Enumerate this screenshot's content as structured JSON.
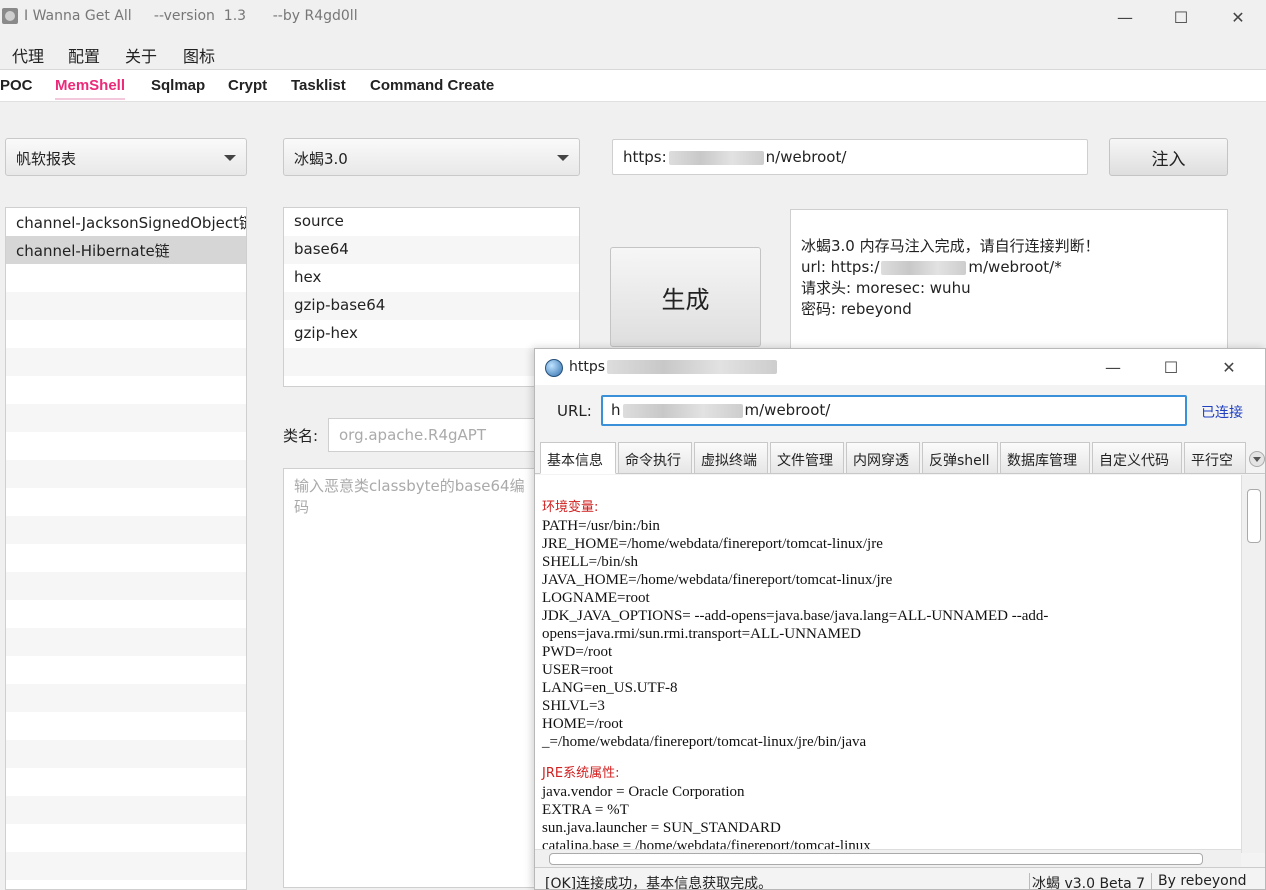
{
  "window": {
    "title": "I Wanna Get All     --version  1.3      --by R4gd0ll",
    "controls": {
      "minimize": "—",
      "maximize": "☐",
      "close": "✕"
    }
  },
  "menu": [
    "代理",
    "配置",
    "关于",
    "图标"
  ],
  "tabs": [
    "POC",
    "MemShell",
    "Sqlmap",
    "Crypt",
    "Tasklist",
    "Command Create"
  ],
  "active_tab": "MemShell",
  "target_select": "帆软报表",
  "tool_select": "冰蝎3.0",
  "url_input": {
    "prefix": "https:",
    "suffix": "n/webroot/"
  },
  "inject_button": "注入",
  "generate_button": "生成",
  "chain_list": [
    "channel-JacksonSignedObject链",
    "channel-Hibernate链"
  ],
  "selected_chain": "channel-Hibernate链",
  "encoding_list": [
    "source",
    "base64",
    "hex",
    "gzip-base64",
    "gzip-hex"
  ],
  "output": {
    "line1": "冰蝎3.0 内存马注入完成，请自行连接判断！",
    "line2_prefix": "url: https:/",
    "line2_suffix": "m/webroot/*",
    "line3": "请求头: moresec: wuhu",
    "line4": "密码: rebeyond"
  },
  "classname_label": "类名:",
  "classname_placeholder": "org.apache.R4gAPT",
  "bytes_placeholder": "输入恶意类classbyte的base64编码",
  "behinder": {
    "title_prefix": "https",
    "controls": {
      "minimize": "—",
      "maximize": "☐",
      "close": "✕"
    },
    "url_label": "URL:",
    "url_prefix": "h",
    "url_suffix": "m/webroot/",
    "status_link": "已连接",
    "tabs": [
      "基本信息",
      "命令执行",
      "虚拟终端",
      "文件管理",
      "内网穿透",
      "反弹shell",
      "数据库管理",
      "自定义代码",
      "平行空"
    ],
    "env_title": "环境变量:",
    "env_lines": [
      "PATH=/usr/bin:/bin",
      "JRE_HOME=/home/webdata/finereport/tomcat-linux/jre",
      "SHELL=/bin/sh",
      "JAVA_HOME=/home/webdata/finereport/tomcat-linux/jre",
      "LOGNAME=root",
      "JDK_JAVA_OPTIONS= --add-opens=java.base/java.lang=ALL-UNNAMED --add-",
      "opens=java.rmi/sun.rmi.transport=ALL-UNNAMED",
      "PWD=/root",
      "USER=root",
      "LANG=en_US.UTF-8",
      "SHLVL=3",
      "HOME=/root",
      "_=/home/webdata/finereport/tomcat-linux/jre/bin/java"
    ],
    "jre_title": "JRE系统属性:",
    "jre_lines": [
      "java.vendor = Oracle Corporation",
      "EXTRA = %T",
      "sun.java.launcher = SUN_STANDARD",
      "catalina.base = /home/webdata/finereport/tomcat-linux"
    ],
    "status_msg": "[OK]连接成功，基本信息获取完成。",
    "status_version": "冰蝎 v3.0 Beta 7",
    "status_by": "By rebeyond"
  }
}
